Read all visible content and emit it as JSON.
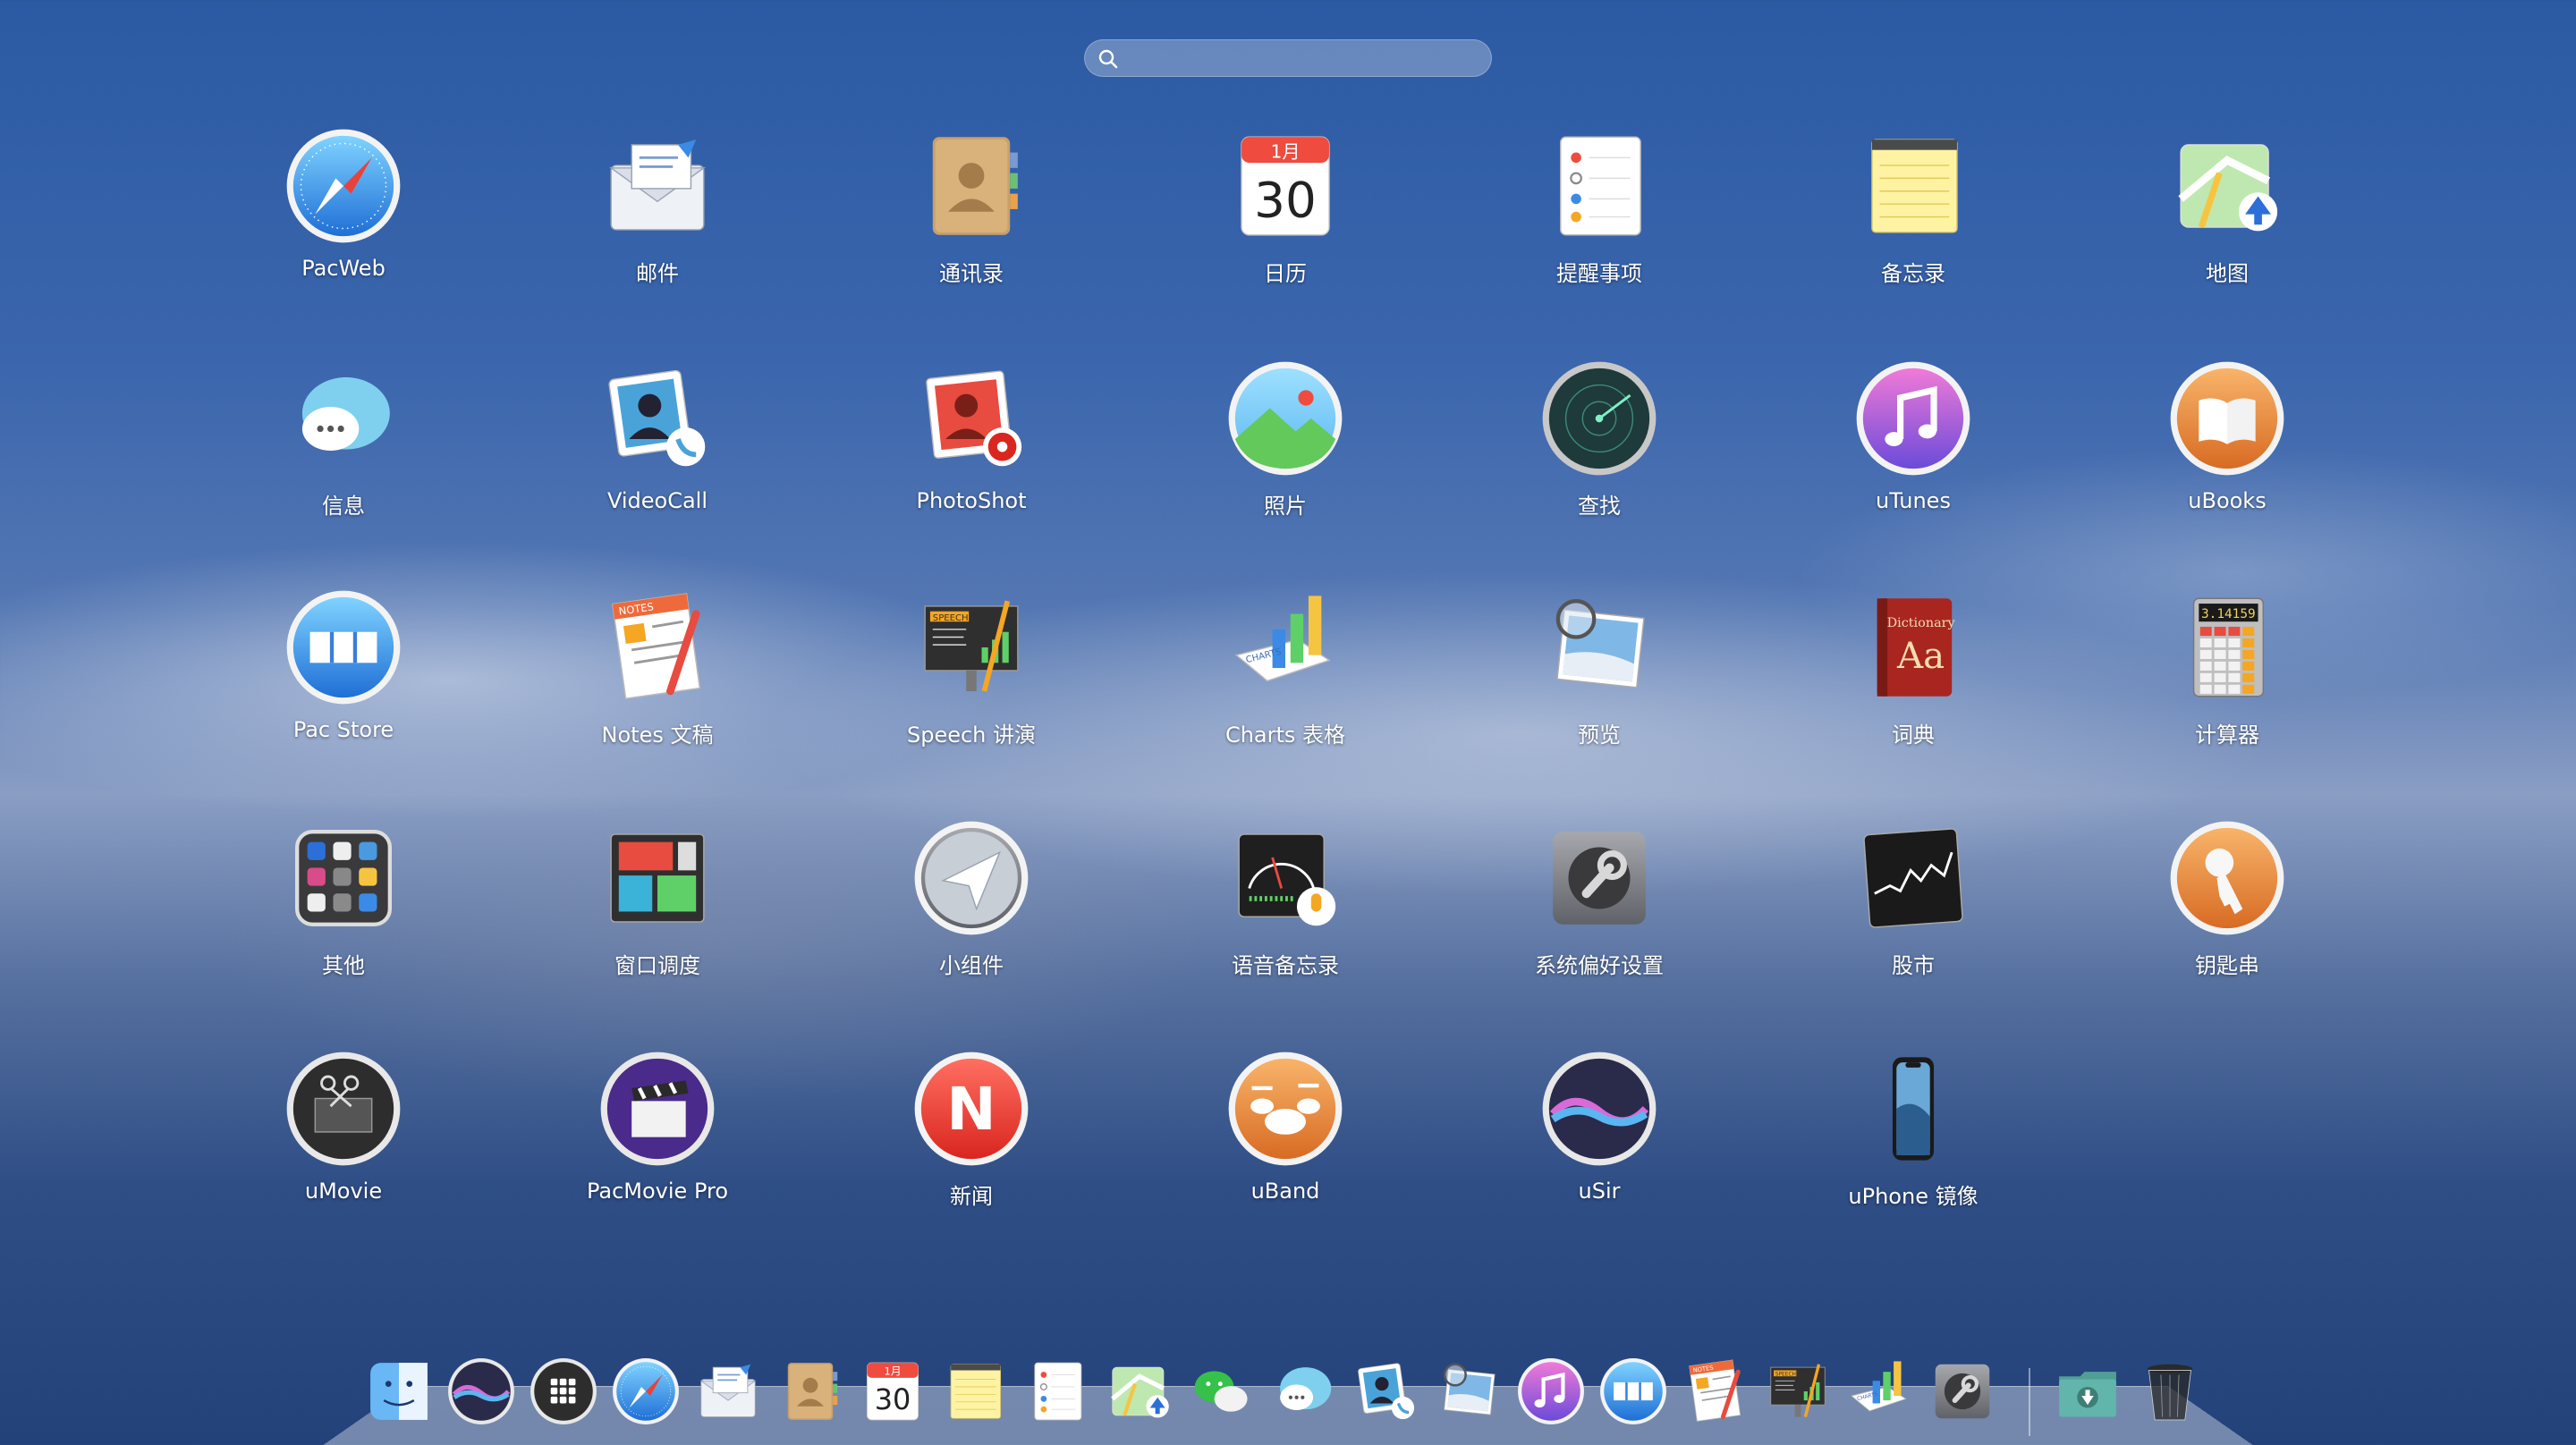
{
  "search": {
    "placeholder": "",
    "value": ""
  },
  "apps": [
    {
      "label": "PacWeb",
      "icon": "safari-compass-icon"
    },
    {
      "label": "邮件",
      "icon": "mail-icon"
    },
    {
      "label": "通讯录",
      "icon": "contacts-icon"
    },
    {
      "label": "日历",
      "icon": "calendar-icon",
      "month": "1月",
      "day": "30"
    },
    {
      "label": "提醒事项",
      "icon": "reminders-icon"
    },
    {
      "label": "备忘录",
      "icon": "notes-icon"
    },
    {
      "label": "地图",
      "icon": "maps-icon"
    },
    {
      "label": "信息",
      "icon": "messages-icon"
    },
    {
      "label": "VideoCall",
      "icon": "videocall-icon"
    },
    {
      "label": "PhotoShot",
      "icon": "photoshot-icon"
    },
    {
      "label": "照片",
      "icon": "photos-icon"
    },
    {
      "label": "查找",
      "icon": "find-radar-icon"
    },
    {
      "label": "uTunes",
      "icon": "music-note-icon"
    },
    {
      "label": "uBooks",
      "icon": "books-icon"
    },
    {
      "label": "Pac Store",
      "icon": "store-icon"
    },
    {
      "label": "Notes 文稿",
      "icon": "pages-icon",
      "badge": "NOTES"
    },
    {
      "label": "Speech 讲演",
      "icon": "keynote-icon",
      "badge": "SPEECH"
    },
    {
      "label": "Charts 表格",
      "icon": "numbers-icon",
      "badge": "CHARTS"
    },
    {
      "label": "预览",
      "icon": "preview-icon"
    },
    {
      "label": "词典",
      "icon": "dictionary-icon",
      "book_title": "Dictionary",
      "book_glyph": "Aa"
    },
    {
      "label": "计算器",
      "icon": "calculator-icon",
      "display": "3.14159"
    },
    {
      "label": "其他",
      "icon": "other-folder-icon"
    },
    {
      "label": "窗口调度",
      "icon": "mission-control-icon"
    },
    {
      "label": "小组件",
      "icon": "widget-send-icon"
    },
    {
      "label": "语音备忘录",
      "icon": "voice-memo-icon"
    },
    {
      "label": "系统偏好设置",
      "icon": "system-preferences-icon"
    },
    {
      "label": "股市",
      "icon": "stocks-icon"
    },
    {
      "label": "钥匙串",
      "icon": "keychain-icon"
    },
    {
      "label": "uMovie",
      "icon": "imovie-icon"
    },
    {
      "label": "PacMovie Pro",
      "icon": "clapper-icon"
    },
    {
      "label": "新闻",
      "icon": "news-icon",
      "glyph": "N"
    },
    {
      "label": "uBand",
      "icon": "drums-icon"
    },
    {
      "label": "uSir",
      "icon": "siri-icon"
    },
    {
      "label": "uPhone 镜像",
      "icon": "iphone-mirror-icon"
    }
  ],
  "dock": [
    "finder-icon",
    "siri-icon",
    "launchpad-icon",
    "safari-compass-icon",
    "mail-icon",
    "contacts-icon",
    "calendar-icon",
    "notes-icon",
    "reminders-icon",
    "maps-icon",
    "wechat-icon",
    "messages-icon",
    "videocall-icon",
    "preview-icon",
    "music-note-icon",
    "store-icon",
    "pages-icon",
    "keynote-icon",
    "numbers-icon",
    "system-preferences-icon",
    "downloads-folder-icon",
    "trash-icon"
  ],
  "colors": {
    "label": "#ffffff",
    "wallpaper_top": "#2b5aa3",
    "wallpaper_bottom": "#24427a"
  }
}
